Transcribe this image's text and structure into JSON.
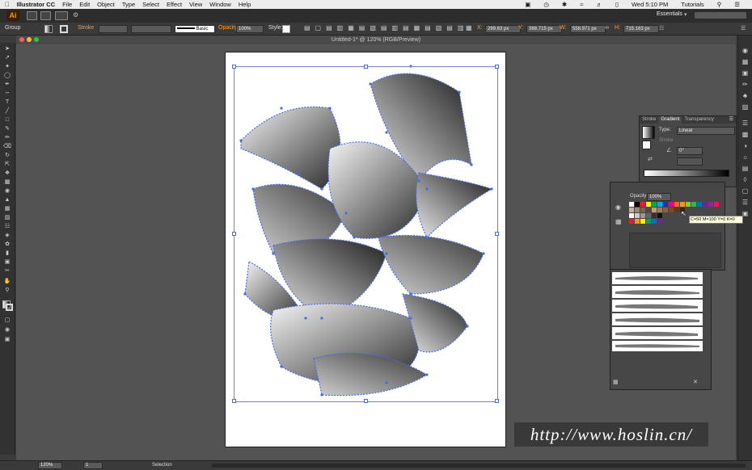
{
  "menubar": {
    "app_name": "Illustrator CC",
    "items": [
      "File",
      "Edit",
      "Object",
      "Type",
      "Select",
      "Effect",
      "View",
      "Window",
      "Help"
    ],
    "clock": "Wed 5:10 PM",
    "user": "Tutorials"
  },
  "appbar": {
    "logo": "Ai",
    "workspace": "Essentials"
  },
  "control": {
    "selection_type": "Group",
    "stroke_label": "Stroke",
    "stroke_value": "",
    "brush": "Basic",
    "opacity_label": "Opacity:",
    "opacity_value": "100%",
    "style_label": "Style:",
    "x_label": "X:",
    "x_value": "299.63 px",
    "y_label": "Y:",
    "y_value": "388.715 px",
    "w_label": "W:",
    "w_value": "558.971 px",
    "h_label": "H:",
    "h_value": "715.163 px"
  },
  "document": {
    "title": "Untitled-1* @ 120% (RGB/Preview)"
  },
  "gradient_panel": {
    "tabs": [
      "Stroke",
      "Gradient",
      "Transparency"
    ],
    "active_tab": "Gradient",
    "type_label": "Type:",
    "type_value": "Linear",
    "stroke_label": "Stroke:",
    "angle_value": "0°"
  },
  "swatch_panel": {
    "opacity_label": "Opacity:",
    "opacity_value": "100%",
    "tooltip": "C=50 M=100 Y=0 K=0"
  },
  "status": {
    "zoom": "120%",
    "page": "1",
    "tool": "Selection"
  },
  "watermark": "http://www.hoslin.cn/",
  "colors": {
    "selection_blue": "#4a6ae0",
    "brand_orange": "#ff9a00"
  }
}
